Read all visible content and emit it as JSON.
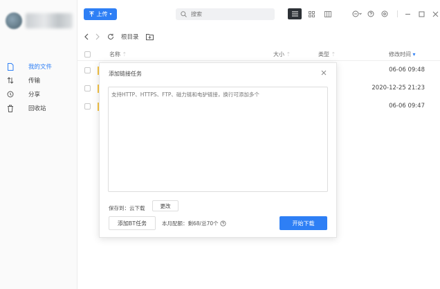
{
  "toolbar": {
    "upload_label": "上传",
    "search_placeholder": "搜索"
  },
  "sidebar": {
    "items": [
      {
        "label": "我的文件",
        "icon": "file-icon",
        "active": true
      },
      {
        "label": "传输",
        "icon": "transfer-icon",
        "active": false
      },
      {
        "label": "分享",
        "icon": "share-icon",
        "active": false
      },
      {
        "label": "回收站",
        "icon": "trash-icon",
        "active": false
      }
    ]
  },
  "breadcrumb": {
    "root_label": "根目录"
  },
  "table": {
    "columns": {
      "name": "名称",
      "size": "大小",
      "type": "类型",
      "modified": "修改时间"
    },
    "rows": [
      {
        "modified": "06-06 09:48"
      },
      {
        "modified": "2020-12-25 21:23"
      },
      {
        "modified": "06-06 09:47"
      }
    ]
  },
  "dialog": {
    "title": "添加链接任务",
    "placeholder": "支持HTTP、HTTPS、FTP、磁力链和电驴链接，换行可添加多个",
    "save_to_label": "保存到：云下载",
    "change_label": "更改",
    "bt_task_label": "添加BT任务",
    "quota_label": "本月配额：剩68/总70个",
    "start_label": "开始下载"
  },
  "colors": {
    "accent": "#2e7ff5",
    "folder": "#f5c343"
  }
}
